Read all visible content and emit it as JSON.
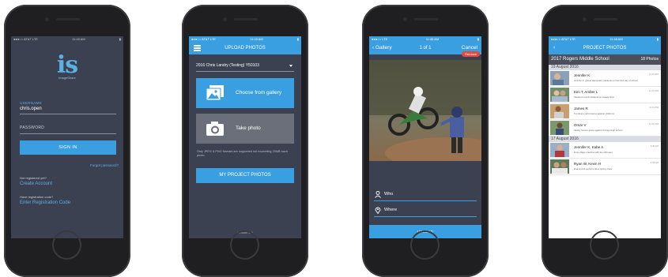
{
  "colors": {
    "accent": "#3a9fe0",
    "dark_bg": "#3b4150",
    "remove": "#e44b3f"
  },
  "login": {
    "status_carrier": "●●●○○ AT&T LTE",
    "status_time": "11:45 AM",
    "logo_text": "is",
    "logo_sub": "ImageShare",
    "username_label": "USERNAME",
    "username_value": "chris.open",
    "password_label": "PASSWORD",
    "signin_label": "SIGN IN",
    "forgot_label": "Forgot password?",
    "not_registered": "Not registered yet?",
    "create_account": "Create Account",
    "have_code": "Have registration code?",
    "enter_code": "Enter Registration Code"
  },
  "upload": {
    "status_carrier": "●●●○○ AT&T LTE",
    "status_time": "11:45 AM",
    "title": "UPLOAD PHOTOS",
    "project": "2016 Chris Landry (Testing) Y50103",
    "gallery_label": "Choose from gallery",
    "photo_label": "Take photo",
    "note": "Only JPEG & PNG formats are supported not exceeding 20MB each photo.",
    "my_projects": "MY PROJECT PHOTOS",
    "version": "Version 2.0"
  },
  "gallery": {
    "status_carrier": "●●●○○ LTE",
    "status_time": "11:46 AM",
    "back_label": "Gallery",
    "counter": "1 of 1",
    "cancel_label": "Cancel",
    "remove_label": "Remove",
    "who_label": "Who",
    "where_label": "Where",
    "upload_label": "UPLOAD"
  },
  "project": {
    "status_carrier": "●●●○○ AT&T LTE",
    "status_time": "11:48 AM",
    "title": "PROJECT PHOTOS",
    "school": "2017 Rogers Middle School",
    "photo_count": "18 Photos",
    "groups": [
      {
        "date": "19 August 2016",
        "items": [
          {
            "name": "Jennifer K.",
            "desc": "Jennifer K. greets elementary students on their first day of school",
            "time": "12:01 PM"
          },
          {
            "name": "Kim T, Amber L",
            "desc": "Student Council students on parade float",
            "time": "12:01 PM"
          },
          {
            "name": "James R",
            "desc": "Trombone performance against Uniforms",
            "time": "12:01 PM"
          },
          {
            "name": "Omar V",
            "desc": "Varsity Soccer game against Orange High School",
            "time": "12:00 PM"
          }
        ]
      },
      {
        "date": "17 August 2016",
        "items": [
          {
            "name": "Jennifer K, Kabe A",
            "desc": "Drum Major marches with the drill team",
            "time": "9:40 AM"
          },
          {
            "name": "Ryan W, Kevin H",
            "desc": "Drama club performs their spring show",
            "time": "9:38 AM"
          }
        ]
      }
    ]
  }
}
